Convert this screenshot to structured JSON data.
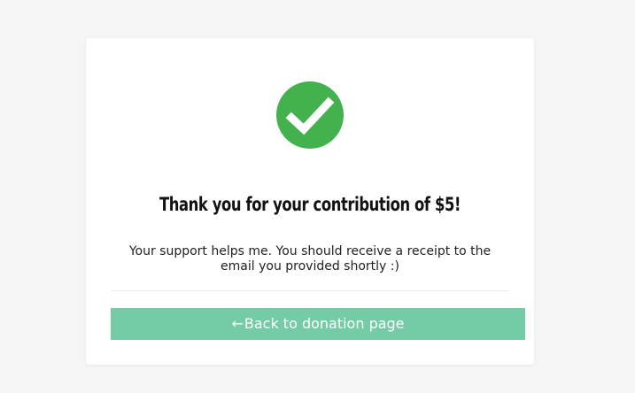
{
  "confirmation": {
    "icon": "check-circle-icon",
    "icon_color": "#43b14e",
    "title": "Thank you for your contribution of $5!",
    "message": "Your support helps me. You should receive a receipt to the email you provided shortly :)"
  },
  "back_button": {
    "arrow": "←",
    "label": "Back to donation page",
    "color": "#74cca6"
  }
}
